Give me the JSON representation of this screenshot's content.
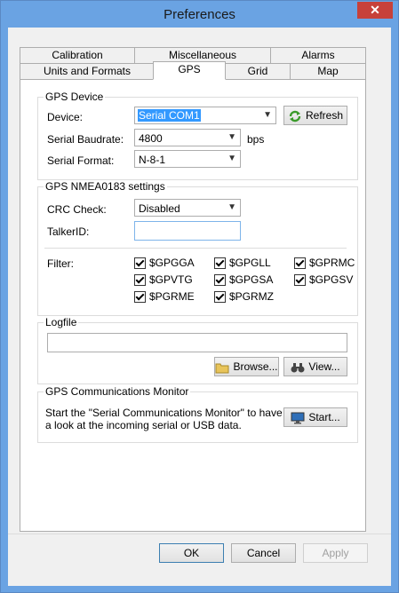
{
  "window": {
    "title": "Preferences",
    "close_glyph": "✕"
  },
  "tabs_row1": [
    "Calibration",
    "Miscellaneous",
    "Alarms"
  ],
  "tabs_row2": [
    "Units and Formats",
    "GPS",
    "Grid",
    "Map"
  ],
  "gps_device": {
    "title": "GPS Device",
    "device_label": "Device:",
    "device_value": "Serial COM1",
    "refresh_label": "Refresh",
    "baud_label": "Serial Baudrate:",
    "baud_value": "4800",
    "baud_unit": "bps",
    "format_label": "Serial Format:",
    "format_value": "N-8-1"
  },
  "nmea": {
    "title": "GPS NMEA0183 settings",
    "crc_label": "CRC Check:",
    "crc_value": "Disabled",
    "talker_label": "TalkerID:",
    "talker_value": "",
    "filter_label": "Filter:",
    "filters": [
      "$GPGGA",
      "$GPGLL",
      "$GPRMC",
      "$GPVTG",
      "$GPGSA",
      "$GPGSV",
      "$PGRME",
      "$PGRMZ"
    ]
  },
  "logfile": {
    "title": "Logfile",
    "path_value": "",
    "browse_label": "Browse...",
    "view_label": "View..."
  },
  "monitor": {
    "title": "GPS Communications Monitor",
    "text_line1": "Start the \"Serial Communications Monitor\" to have",
    "text_line2": "a look at the incoming serial or USB data.",
    "start_label": "Start..."
  },
  "footer": {
    "ok_label": "OK",
    "cancel_label": "Cancel",
    "apply_label": "Apply"
  },
  "colors": {
    "titlebar": "#6aa3e3",
    "close": "#c7413a",
    "selection": "#3399ff"
  }
}
